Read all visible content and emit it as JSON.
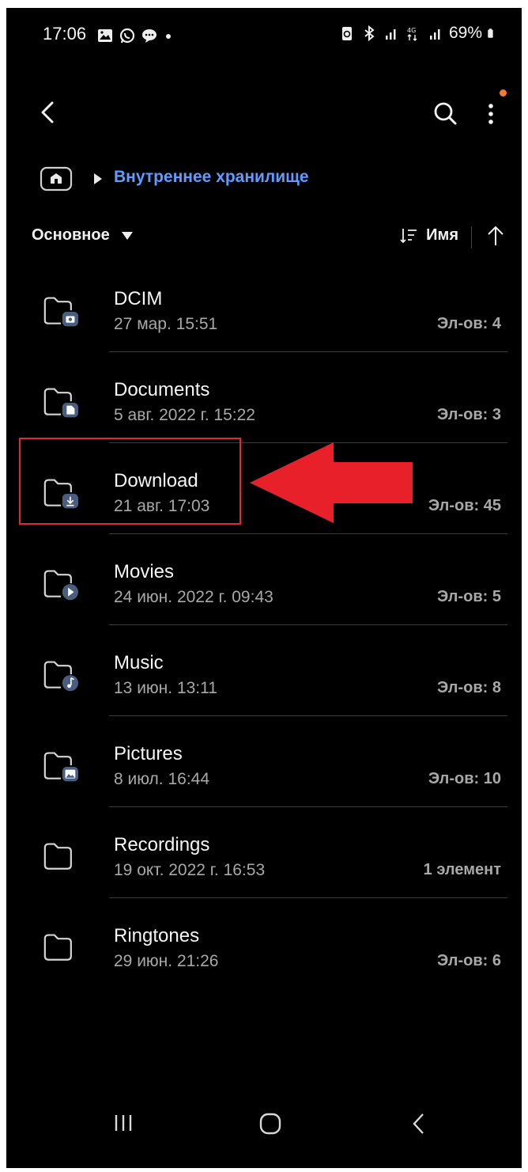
{
  "status_bar": {
    "time": "17:06",
    "battery": "69%",
    "left_icons": [
      "gallery-icon",
      "whatsapp-icon",
      "chat-icon"
    ],
    "right_icons": [
      "battery-saver-icon",
      "bluetooth-icon",
      "signal-icon",
      "4g-icon",
      "signal-icon",
      "battery-icon"
    ]
  },
  "top_bar": {
    "back_icon": "chevron-left-icon",
    "search_icon": "search-icon",
    "more_icon": "more-vertical-icon",
    "notification_dot_color": "#f47c2e"
  },
  "breadcrumb": {
    "home_icon": "home-icon",
    "label": "Внутреннее хранилище",
    "color": "#5e9cff"
  },
  "filter": {
    "label": "Основное"
  },
  "sort": {
    "label": "Имя",
    "direction_icon": "arrow-up-icon"
  },
  "folders": [
    {
      "name": "DCIM",
      "date": "27 мар. 15:51",
      "count": "Эл-ов: 4",
      "badge": "camera"
    },
    {
      "name": "Documents",
      "date": "5 авг. 2022 г. 15:22",
      "count": "Эл-ов: 3",
      "badge": "document"
    },
    {
      "name": "Download",
      "date": "21 авг. 17:03",
      "count": "Эл-ов: 45",
      "badge": "download"
    },
    {
      "name": "Movies",
      "date": "24 июн. 2022 г. 09:43",
      "count": "Эл-ов: 5",
      "badge": "play"
    },
    {
      "name": "Music",
      "date": "13 июн. 13:11",
      "count": "Эл-ов: 8",
      "badge": "music"
    },
    {
      "name": "Pictures",
      "date": "8 июл. 16:44",
      "count": "Эл-ов: 10",
      "badge": "image"
    },
    {
      "name": "Recordings",
      "date": "19 окт. 2022 г. 16:53",
      "count": "1 элемент",
      "badge": "none"
    },
    {
      "name": "Ringtones",
      "date": "29 июн. 21:26",
      "count": "Эл-ов: 6",
      "badge": "none"
    }
  ],
  "annotation": {
    "highlight_color": "#e22a2a",
    "highlighted_folder": "Download"
  },
  "nav_bar": {
    "recent_icon": "recent-apps-icon",
    "home_icon": "home-button-icon",
    "back_icon": "back-icon"
  },
  "colors": {
    "background": "#000000",
    "badge": "#4a5d7e",
    "accent": "#5e9cff"
  }
}
